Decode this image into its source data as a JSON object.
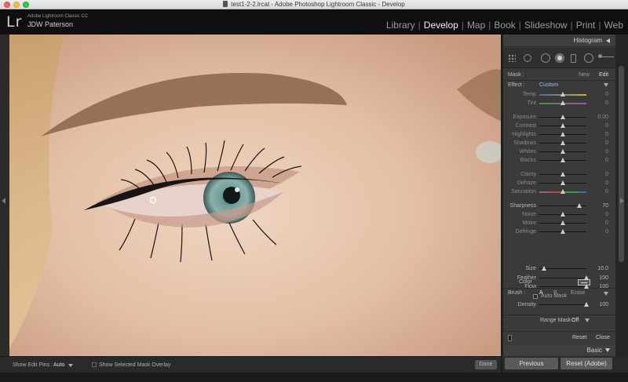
{
  "window": {
    "title": "test1-2-2.lrcat - Adobe Photoshop Lightroom Classic - Develop"
  },
  "identity": {
    "logo": "Lr",
    "app_name": "Adobe Lightroom Classic CC",
    "user": "JDW Paterson"
  },
  "modules": [
    {
      "label": "Library",
      "active": false
    },
    {
      "label": "Develop",
      "active": true
    },
    {
      "label": "Map",
      "active": false
    },
    {
      "label": "Book",
      "active": false
    },
    {
      "label": "Slideshow",
      "active": false
    },
    {
      "label": "Print",
      "active": false
    },
    {
      "label": "Web",
      "active": false
    }
  ],
  "panel": {
    "histogram_label": "Histogram",
    "mask_label": "Mask :",
    "mask_new": "New",
    "mask_edit": "Edit",
    "effect_label": "Effect :",
    "effect_value": "Custom",
    "sliders": [
      {
        "label": "Temp",
        "value": "0",
        "pos": 0.5,
        "track": "temp",
        "dim": true
      },
      {
        "label": "Tint",
        "value": "0",
        "pos": 0.5,
        "track": "tint",
        "dim": true
      },
      {
        "label": "Exposure",
        "value": "0.00",
        "pos": 0.5,
        "track": "plain",
        "dim": true
      },
      {
        "label": "Contrast",
        "value": "0",
        "pos": 0.5,
        "track": "plain",
        "dim": true
      },
      {
        "label": "Highlights",
        "value": "0",
        "pos": 0.5,
        "track": "plain",
        "dim": true
      },
      {
        "label": "Shadows",
        "value": "0",
        "pos": 0.5,
        "track": "plain",
        "dim": true
      },
      {
        "label": "Whites",
        "value": "0",
        "pos": 0.5,
        "track": "plain",
        "dim": true
      },
      {
        "label": "Blacks",
        "value": "0",
        "pos": 0.5,
        "track": "plain",
        "dim": true
      },
      {
        "label": "Clarity",
        "value": "0",
        "pos": 0.5,
        "track": "plain",
        "dim": true
      },
      {
        "label": "Dehaze",
        "value": "0",
        "pos": 0.5,
        "track": "plain",
        "dim": true
      },
      {
        "label": "Saturation",
        "value": "0",
        "pos": 0.5,
        "track": "sat",
        "dim": true
      },
      {
        "label": "Sharpness",
        "value": "70",
        "pos": 0.85,
        "track": "plain",
        "dim": false
      },
      {
        "label": "Noise",
        "value": "0",
        "pos": 0.5,
        "track": "plain",
        "dim": true
      },
      {
        "label": "Moire",
        "value": "0",
        "pos": 0.5,
        "track": "plain",
        "dim": true
      },
      {
        "label": "Defringe",
        "value": "0",
        "pos": 0.5,
        "track": "plain",
        "dim": true
      }
    ],
    "color_label": "Color",
    "brush_label": "Brush :",
    "brush_a": "A",
    "brush_b": "B",
    "brush_erase": "Erase",
    "brush_sliders": [
      {
        "label": "Size",
        "value": "10.0",
        "pos": 0.1
      },
      {
        "label": "Feather",
        "value": "100",
        "pos": 1.0
      },
      {
        "label": "Flow",
        "value": "100",
        "pos": 1.0
      }
    ],
    "auto_mask_label": "Auto Mask",
    "density": {
      "label": "Density",
      "value": "100",
      "pos": 1.0
    },
    "range_mask_label": "Range Mask :",
    "range_mask_value": "Off",
    "reset_label": "Reset",
    "close_label": "Close",
    "basic_label": "Basic"
  },
  "toolbar": {
    "show_pins_label": "Show Edit Pins :",
    "show_pins_value": "Auto",
    "show_overlay_label": "Show Selected Mask Overlay",
    "done_label": "Done"
  },
  "buttons": {
    "previous": "Previous",
    "reset_adobe": "Reset (Adobe)"
  }
}
